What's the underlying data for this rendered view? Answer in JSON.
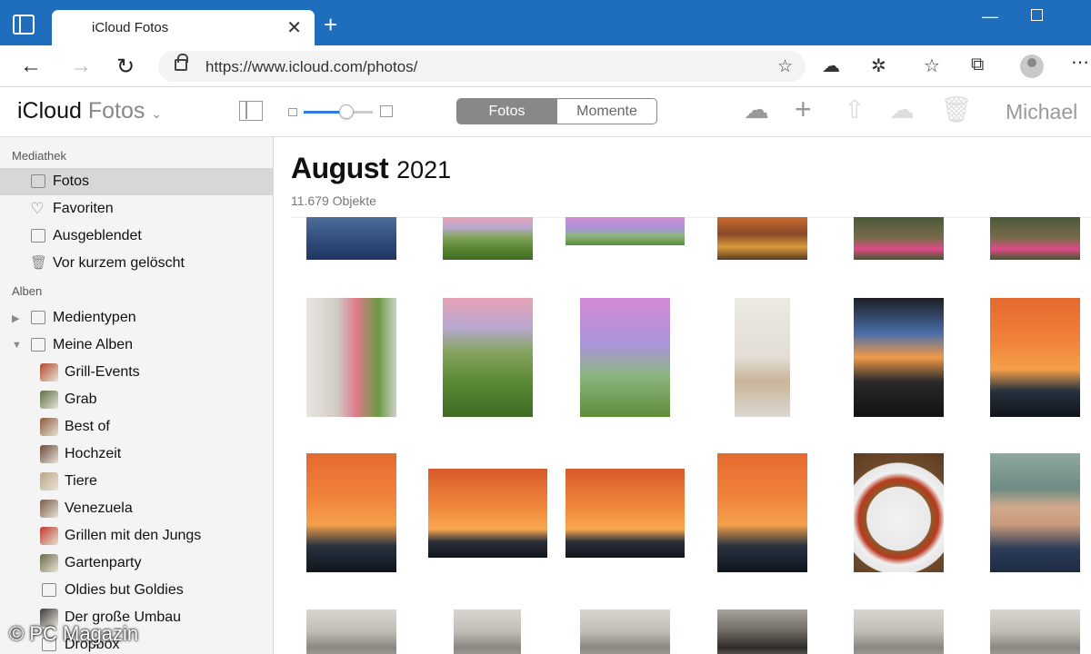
{
  "browser": {
    "tab_title": "iCloud Fotos",
    "url_scheme": "https://",
    "url_domain": "www.icloud.com",
    "url_path": "/photos/"
  },
  "app": {
    "title_main": "iCloud",
    "title_sub": "Fotos",
    "segments": [
      "Fotos",
      "Momente"
    ],
    "active_segment": "Fotos",
    "user_name": "Michael",
    "zoom_level_fraction": 0.62
  },
  "sidebar": {
    "section_library": "Mediathek",
    "library_items": [
      {
        "label": "Fotos",
        "icon": "photos-icon",
        "selected": true
      },
      {
        "label": "Favoriten",
        "icon": "heart-icon",
        "selected": false
      },
      {
        "label": "Ausgeblendet",
        "icon": "hidden-icon",
        "selected": false
      },
      {
        "label": "Vor kurzem gelöscht",
        "icon": "trash-icon",
        "selected": false
      }
    ],
    "section_albums": "Alben",
    "album_groups": [
      {
        "label": "Medientypen",
        "expanded": false
      },
      {
        "label": "Meine Alben",
        "expanded": true
      }
    ],
    "albums": [
      {
        "label": "Grill-Events",
        "thumb_color": "#b24a2e"
      },
      {
        "label": "Grab",
        "thumb_color": "#5b7048"
      },
      {
        "label": "Best of",
        "thumb_color": "#8a5a3a"
      },
      {
        "label": "Hochzeit",
        "thumb_color": "#6a4a3a"
      },
      {
        "label": "Tiere",
        "thumb_color": "#b9a58a"
      },
      {
        "label": "Venezuela",
        "thumb_color": "#7a5a4a"
      },
      {
        "label": "Grillen mit den Jungs",
        "thumb_color": "#c0392b"
      },
      {
        "label": "Gartenparty",
        "thumb_color": "#6f6a4a"
      },
      {
        "label": "Oldies but Goldies",
        "thumb_color": "none"
      },
      {
        "label": "Der große Umbau",
        "thumb_color": "#3a3a3a"
      },
      {
        "label": "Dropbox",
        "thumb_color": "none"
      }
    ]
  },
  "main": {
    "month_bold": "August",
    "year": "2021",
    "count": "11.679 Objekte"
  },
  "watermark": "© PC Magazin"
}
